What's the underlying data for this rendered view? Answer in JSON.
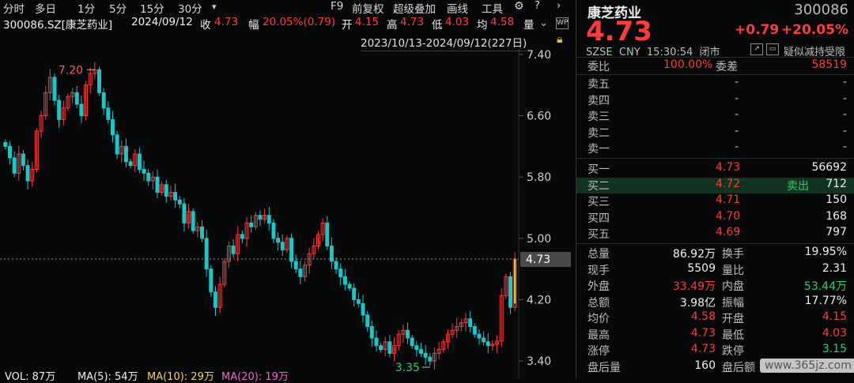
{
  "toolbar": {
    "left_tabs": [
      "分时",
      "多日",
      "1分",
      "5分",
      "15分",
      "30分",
      "▾"
    ],
    "right_tabs": [
      "F9",
      "前复权",
      "超级叠加",
      "画线",
      "工具"
    ],
    "icons": [
      "gear-icon",
      "help-icon",
      "chevron-right-icon"
    ]
  },
  "info": {
    "code_name": "300086.SZ[康芝药业]",
    "date": "2024/09/12",
    "close_label": "收",
    "close": "4.73",
    "amp_label": "幅",
    "amp": "20.05%(0.79)",
    "open_label": "开",
    "open": "4.15",
    "high_label": "高",
    "high": "4.73",
    "low_label": "低",
    "low": "4.03",
    "avg_label": "均",
    "avg": "4.58",
    "vol_label": "量"
  },
  "range_text": "2023/10/13-2024/09/12(227日)",
  "chart_data": {
    "type": "candlestick",
    "y_ticks": [
      "7.40",
      "6.60",
      "5.80",
      "5.00",
      "4.20",
      "3.40"
    ],
    "ylim": [
      3.35,
      7.45
    ],
    "high_marker": "7.20",
    "low_marker": "3.35",
    "current_price": "4.73",
    "closes": [
      6.2,
      6.05,
      5.85,
      6.1,
      5.95,
      5.75,
      5.9,
      6.4,
      6.6,
      6.9,
      7.1,
      6.8,
      6.55,
      6.7,
      6.85,
      6.9,
      6.75,
      6.6,
      7.0,
      7.15,
      7.2,
      6.9,
      6.7,
      6.55,
      6.35,
      6.1,
      6.2,
      6.0,
      5.95,
      6.1,
      5.9,
      5.85,
      5.75,
      5.8,
      5.6,
      5.7,
      5.55,
      5.6,
      5.5,
      5.45,
      5.2,
      5.35,
      5.1,
      5.15,
      5.0,
      4.6,
      4.3,
      4.1,
      4.4,
      4.7,
      4.9,
      4.8,
      5.05,
      5.0,
      5.2,
      5.15,
      5.3,
      5.25,
      5.3,
      5.2,
      5.0,
      4.95,
      4.85,
      5.0,
      4.7,
      4.6,
      4.5,
      4.65,
      4.8,
      4.9,
      5.05,
      5.2,
      4.9,
      4.7,
      4.6,
      4.5,
      4.4,
      4.35,
      4.2,
      4.15,
      4.0,
      3.85,
      3.7,
      3.6,
      3.55,
      3.65,
      3.5,
      3.6,
      3.75,
      3.8,
      3.7,
      3.6,
      3.55,
      3.5,
      3.45,
      3.4,
      3.5,
      3.55,
      3.65,
      3.75,
      3.8,
      3.85,
      3.9,
      3.95,
      3.85,
      3.75,
      3.7,
      3.65,
      3.6,
      3.62,
      3.66,
      4.25,
      4.5,
      4.1,
      4.73
    ],
    "volume_bar": {
      "vol_label": "VOL: 87万",
      "ma5": "MA(5): 54万",
      "ma10": "MA(10): 29万",
      "ma20": "MA(20): 19万"
    }
  },
  "quote": {
    "name": "康芝药业",
    "code": "300086",
    "price": "4.73",
    "change": "+0.79",
    "change_pct": "+20.05%",
    "meta": "SZSE  CNY  15:30:54  闭市",
    "tag": "疑似减持受限",
    "ratio_label": "委比",
    "ratio": "100.00%",
    "diff_label": "委差",
    "diff": "58519",
    "asks": [
      {
        "label": "卖五",
        "price": "-",
        "vol": "-"
      },
      {
        "label": "卖四",
        "price": "-",
        "vol": "-"
      },
      {
        "label": "卖三",
        "price": "-",
        "vol": "-"
      },
      {
        "label": "卖二",
        "price": "-",
        "vol": "-"
      },
      {
        "label": "卖一",
        "price": "-",
        "vol": "-"
      }
    ],
    "bids": [
      {
        "label": "买一",
        "price": "4.73",
        "extra": "",
        "vol": "56692"
      },
      {
        "label": "买二",
        "price": "4.72",
        "extra": "卖出",
        "vol": "712"
      },
      {
        "label": "买三",
        "price": "4.71",
        "extra": "",
        "vol": "150"
      },
      {
        "label": "买四",
        "price": "4.70",
        "extra": "",
        "vol": "168"
      },
      {
        "label": "买五",
        "price": "4.69",
        "extra": "",
        "vol": "797"
      }
    ],
    "stats": [
      {
        "l1": "总量",
        "v1": "86.92万",
        "c1": "white",
        "l2": "换手",
        "v2": "19.95%",
        "c2": "white"
      },
      {
        "l1": "现手",
        "v1": "5509",
        "c1": "white",
        "l2": "量比",
        "v2": "2.31",
        "c2": "white"
      },
      {
        "l1": "外盘",
        "v1": "33.49万",
        "c1": "red",
        "l2": "内盘",
        "v2": "53.44万",
        "c2": "green"
      },
      {
        "l1": "总额",
        "v1": "3.98亿",
        "c1": "white",
        "l2": "振幅",
        "v2": "17.77%",
        "c2": "white"
      },
      {
        "l1": "均价",
        "v1": "4.58",
        "c1": "red",
        "l2": "开盘",
        "v2": "4.15",
        "c2": "red"
      },
      {
        "l1": "最高",
        "v1": "4.73",
        "c1": "red",
        "l2": "最低",
        "v2": "4.03",
        "c2": "red"
      },
      {
        "l1": "涨停",
        "v1": "4.73",
        "c1": "red",
        "l2": "跌停",
        "v2": "3.15",
        "c2": "green"
      },
      {
        "l1": "盘后量",
        "v1": "160",
        "c1": "white",
        "l2": "盘后额",
        "v2": "",
        "c2": "white"
      }
    ],
    "watermark": "www.365jz.com"
  },
  "colors": {
    "up": "#ff3b3b",
    "down": "#18c8c8",
    "bg": "#07080a",
    "grid": "#1a1a1a"
  }
}
